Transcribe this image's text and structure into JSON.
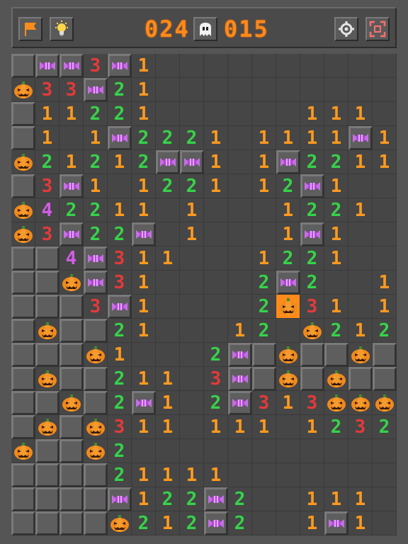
{
  "toolbar": {
    "flag_icon": "flag-icon",
    "hint_icon": "lightbulb-icon",
    "mines_left": "024",
    "status_icon": "ghost-icon",
    "timer": "015",
    "settings_icon": "gear-icon",
    "fullscreen_icon": "fullscreen-icon"
  },
  "colors": {
    "one": "#ff9a1f",
    "two": "#36d34a",
    "three": "#e33a3a",
    "four": "#d35ce6",
    "pumpkin": "#f08a1c",
    "candy": "#b04bd6",
    "hit_cell": "#ff8c1a"
  },
  "legend": {
    "#": "covered tile",
    ".": "empty revealed tile",
    "C": "candy flag",
    "P": "pumpkin",
    "X": "pumpkin on orange (triggered)",
    "1-4": "adjacent count"
  },
  "board": {
    "cols": 16,
    "rows": 20,
    "grid": [
      "#CC3C1.........",
      "P33C21..........",
      "#11221......111",
      "#1.1C2221.1111C1",
      "P21212CC1.1C2211",
      "#3C1.1221.12C1..",
      "P42211.1...1221.",
      "P3C22C.1...1C1..",
      "##4C311...1221..",
      "##PC31....2C2..11",
      "###3C1....2X31.1P",
      "#P##21...12.P212#",
      "###P1...2C#P##P#",
      "#P##211.3C#P#P##",
      "##P#2C1.2C313PPP",
      "#P#P311.111.1232",
      "P##P2..........",
      "####21111.......",
      "####C122C2..111.",
      "####P212C2..1C1."
    ]
  }
}
